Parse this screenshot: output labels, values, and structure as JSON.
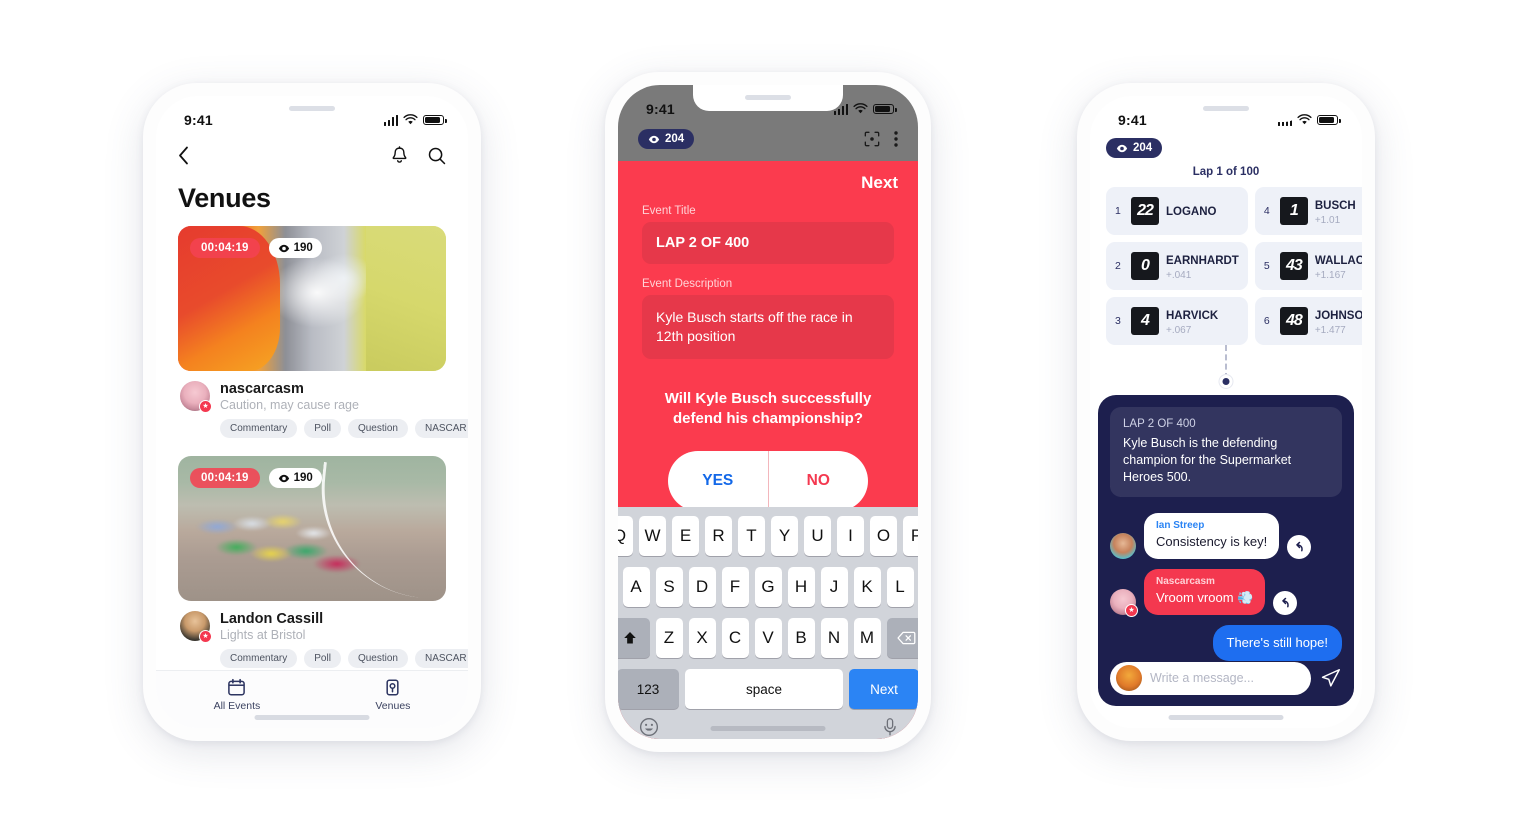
{
  "phone1": {
    "status": {
      "time": "9:41"
    },
    "nav": {
      "back_icon": "chevron-left-icon",
      "bell_icon": "bell-icon",
      "search_icon": "search-icon"
    },
    "title": "Venues",
    "cards": [
      {
        "timer": "00:04:19",
        "views": "190",
        "name": "nascarcasm",
        "subtitle": "Caution, may cause rage",
        "tags": [
          "Commentary",
          "Poll",
          "Question",
          "NASCAR"
        ]
      },
      {
        "timer": "00:04:19",
        "views": "190",
        "name": "Landon Cassill",
        "subtitle": "Lights at Bristol",
        "tags": [
          "Commentary",
          "Poll",
          "Question",
          "NASCAR"
        ]
      }
    ],
    "tabs": [
      {
        "label": "All Events",
        "icon": "calendar-icon"
      },
      {
        "label": "Venues",
        "icon": "venue-icon"
      }
    ]
  },
  "phone2": {
    "status": {
      "time": "9:41"
    },
    "topbar": {
      "views": "204",
      "scan_icon": "focus-scan-icon",
      "menu_icon": "more-vertical-icon"
    },
    "next_label": "Next",
    "form": {
      "title_label": "Event Title",
      "title_value": "LAP 2 OF 400",
      "desc_label": "Event Description",
      "desc_value": "Kyle Busch starts off the race in 12th position"
    },
    "question": "Will Kyle Busch successfully defend his championship?",
    "yes_label": "YES",
    "no_label": "NO",
    "keyboard": {
      "row1": [
        "Q",
        "W",
        "E",
        "R",
        "T",
        "Y",
        "U",
        "I",
        "O",
        "P"
      ],
      "row2": [
        "A",
        "S",
        "D",
        "F",
        "G",
        "H",
        "J",
        "K",
        "L"
      ],
      "row3": [
        "Z",
        "X",
        "C",
        "V",
        "B",
        "N",
        "M"
      ],
      "shift_icon": "shift-arrow-icon",
      "backspace_icon": "backspace-icon",
      "num_label": "123",
      "space_label": "space",
      "return_label": "Next",
      "emoji_icon": "emoji-smiley-icon",
      "mic_icon": "microphone-icon"
    }
  },
  "phone3": {
    "status": {
      "time": "9:41"
    },
    "views": "204",
    "lap_label": "Lap 1 of 100",
    "leaderboard": [
      {
        "pos": "1",
        "car": "22",
        "name": "LOGANO",
        "gap": ""
      },
      {
        "pos": "4",
        "car": "1",
        "name": "BUSCH",
        "gap": "+1.01"
      },
      {
        "pos": "2",
        "car": "0",
        "name": "EARNHARDT",
        "gap": "+.041"
      },
      {
        "pos": "5",
        "car": "43",
        "name": "WALLACE",
        "gap": "+1.167"
      },
      {
        "pos": "3",
        "car": "4",
        "name": "HARVICK",
        "gap": "+.067"
      },
      {
        "pos": "6",
        "car": "48",
        "name": "JOHNSON",
        "gap": "+1.477"
      }
    ],
    "pinned": {
      "title": "LAP 2 OF 400",
      "body": "Kyle Busch is the defending champion for the Supermarket Heroes 500."
    },
    "messages": [
      {
        "name": "Ian Streep",
        "text": "Consistency is key!",
        "style": "white",
        "reply_icon": "reply-arrow-icon"
      },
      {
        "name": "Nascarcasm",
        "text": "Vroom vroom 💨",
        "style": "red",
        "reply_icon": "reply-arrow-icon"
      },
      {
        "name": "",
        "text": "There's still hope!",
        "style": "blue",
        "reply_icon": ""
      }
    ],
    "composer": {
      "placeholder": "Write a message...",
      "send_icon": "send-paper-plane-icon"
    }
  },
  "colors": {
    "accent_red": "#fb3b4e",
    "accent_blue": "#1e6ef0",
    "navy": "#1d1f4e"
  }
}
